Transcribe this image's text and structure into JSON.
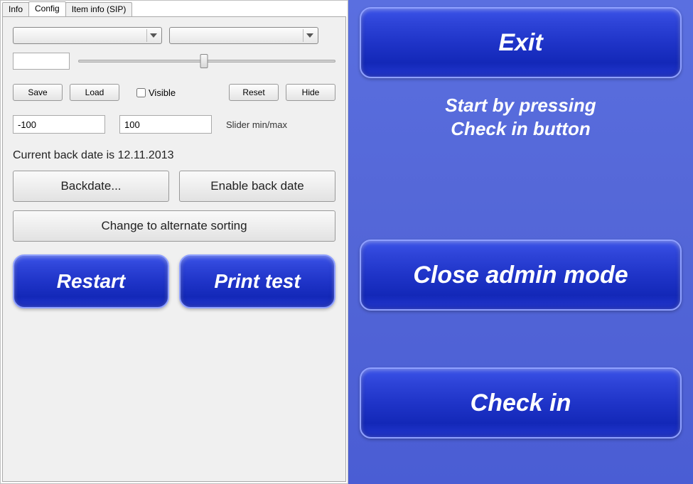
{
  "tabs": {
    "info": "Info",
    "config": "Config",
    "item_info": "Item info (SIP)"
  },
  "config": {
    "save": "Save",
    "load": "Load",
    "visible_label": "Visible",
    "reset": "Reset",
    "hide": "Hide",
    "slider_min": "-100",
    "slider_max": "100",
    "slider_label": "Slider min/max",
    "backdate_status": "Current back date is 12.11.2013",
    "backdate_btn": "Backdate...",
    "enable_backdate_btn": "Enable back date",
    "alt_sort_btn": "Change to alternate sorting",
    "restart": "Restart",
    "print_test": "Print test"
  },
  "right": {
    "exit": "Exit",
    "hint_line1": "Start by pressing",
    "hint_line2": "Check in button",
    "close_admin": "Close admin mode",
    "check_in": "Check in"
  }
}
